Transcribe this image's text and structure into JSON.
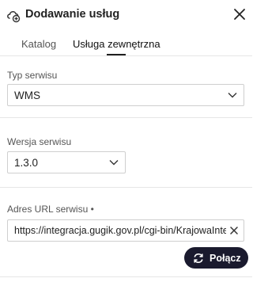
{
  "header": {
    "title": "Dodawanie usług",
    "logo_icon": "cloud-plus-icon",
    "close_icon": "close-icon"
  },
  "tabs": [
    {
      "label": "Katalog",
      "active": false
    },
    {
      "label": "Usługa zewnętrzna",
      "active": true
    }
  ],
  "service_type": {
    "label": "Typ serwisu",
    "value": "WMS"
  },
  "service_version": {
    "label": "Wersja serwisu",
    "value": "1.3.0"
  },
  "service_url": {
    "label": "Adres URL serwisu •",
    "value": "https://integracja.gugik.gov.pl/cgi-bin/KrajowaIntegracjaEwidencjiGruntow"
  },
  "connect_button": {
    "label": "Połącz",
    "icon": "refresh-icon"
  },
  "colors": {
    "button_bg": "#1a1a2e",
    "border": "#cfcfcf",
    "divider": "#e6e6e6"
  }
}
